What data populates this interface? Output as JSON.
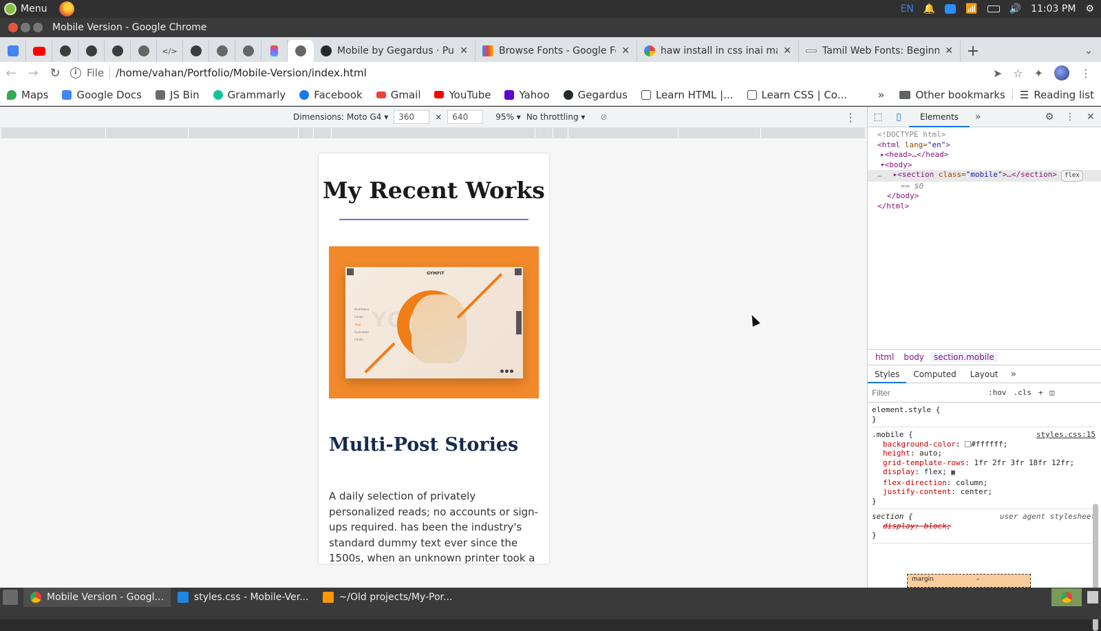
{
  "os": {
    "menu_label": "Menu",
    "lang": "EN",
    "clock": "11:03 PM"
  },
  "window": {
    "title": "Mobile Version - Google Chrome"
  },
  "tabs": [
    {
      "title": "Mobile by Gegardus · Pull",
      "favicon": "github-icon"
    },
    {
      "title": "Browse Fonts - Google Fo",
      "favicon": "google-fonts-icon"
    },
    {
      "title": "haw install in css inai mat",
      "favicon": "google-icon"
    },
    {
      "title": "Tamil Web Fonts: Beginne",
      "favicon": "web-icon"
    }
  ],
  "address": {
    "scheme": "File",
    "url": "/home/vahan/Portfolio/Mobile-Version/index.html"
  },
  "bookmarks": [
    {
      "label": "Maps",
      "color": "#34a853"
    },
    {
      "label": "Google Docs",
      "color": "#4285f4"
    },
    {
      "label": "JS Bin",
      "color": "#6b6b6b"
    },
    {
      "label": "Grammarly",
      "color": "#15c39a"
    },
    {
      "label": "Facebook",
      "color": "#1877f2"
    },
    {
      "label": "Gmail",
      "color": "#ea4335"
    },
    {
      "label": "YouTube",
      "color": "#ff0000"
    },
    {
      "label": "Yahoo",
      "color": "#6001d2"
    },
    {
      "label": "Gegardus",
      "color": "#24292e"
    },
    {
      "label": "Learn HTML |...",
      "color": "#444444"
    },
    {
      "label": "Learn CSS | Co...",
      "color": "#444444"
    }
  ],
  "bookmarks_right": {
    "other": "Other bookmarks",
    "reading": "Reading list"
  },
  "device": {
    "dimensions": "Dimensions: Moto G4 ▾",
    "width": "360",
    "times": "×",
    "height": "640",
    "zoom": "95% ▾",
    "throttle": "No throttling ▾"
  },
  "page": {
    "title": "My Recent Works",
    "image_brand": "GYMFIT",
    "image_word": "YOGA",
    "image_menu": [
      "Meditation",
      "Cardio",
      "Yoga",
      "Gymnastic",
      "Cardio"
    ],
    "post_title": "Multi-Post Stories",
    "post_text": "A daily selection of privately personalized reads; no accounts or sign-ups required. has been the industry's standard dummy text ever since the 1500s, when an unknown printer took a standard dummy"
  },
  "devtools": {
    "tab_elements": "Elements",
    "dom": {
      "doctype": "<!DOCTYPE html>",
      "html_open_tag": "<html",
      "html_attr_name": " lang=",
      "html_attr_val": "\"en\"",
      "html_open_end": ">",
      "head": "▸<head>…</head>",
      "body_open": "▾<body>",
      "section_open": "▸<section",
      "section_attr_name": " class=",
      "section_attr_val": "\"mobile\"",
      "section_close": ">…</section>",
      "flex_badge": "flex",
      "eq": "== $0",
      "body_close": "</body>",
      "html_close": "</html>"
    },
    "crumbs": [
      "html",
      "body",
      "section.mobile"
    ],
    "subtabs": [
      "Styles",
      "Computed",
      "Layout"
    ],
    "filter_placeholder": "Filter",
    "filter_buttons": [
      ":hov",
      ".cls",
      "+"
    ],
    "rules": {
      "element_style": "element.style {",
      "close": "}",
      "mobile_selector": ".mobile {",
      "mobile_src": "styles.css:15",
      "props": [
        {
          "name": "background-color",
          "value": "#ffffff;"
        },
        {
          "name": "height",
          "value": "auto;"
        },
        {
          "name": "grid-template-rows",
          "value": "1fr 2fr 3fr 18fr 12fr;"
        },
        {
          "name": "display",
          "value": "flex;"
        },
        {
          "name": "flex-direction",
          "value": "column;"
        },
        {
          "name": "justify-content",
          "value": "center;"
        }
      ],
      "section_selector": "section {",
      "section_src": "user agent stylesheet",
      "section_prop": "display: block;"
    },
    "boxmodel_label": "margin",
    "boxmodel_value": "–"
  },
  "taskbar": [
    {
      "label": "Mobile Version - Googl...",
      "color": "#4285f4",
      "active": true
    },
    {
      "label": "styles.css - Mobile-Ver...",
      "color": "#1e88e5",
      "active": false
    },
    {
      "label": "~/Old projects/My-Por...",
      "color": "#ff9800",
      "active": false
    }
  ]
}
